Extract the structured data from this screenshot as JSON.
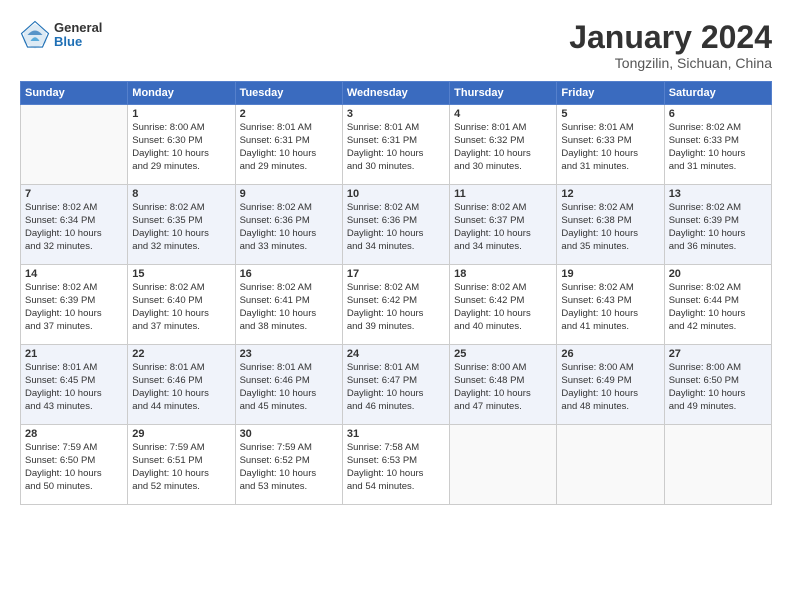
{
  "header": {
    "logo_general": "General",
    "logo_blue": "Blue",
    "month_title": "January 2024",
    "location": "Tongzilin, Sichuan, China"
  },
  "calendar": {
    "days_of_week": [
      "Sunday",
      "Monday",
      "Tuesday",
      "Wednesday",
      "Thursday",
      "Friday",
      "Saturday"
    ],
    "weeks": [
      [
        {
          "day": "",
          "info": ""
        },
        {
          "day": "1",
          "info": "Sunrise: 8:00 AM\nSunset: 6:30 PM\nDaylight: 10 hours\nand 29 minutes."
        },
        {
          "day": "2",
          "info": "Sunrise: 8:01 AM\nSunset: 6:31 PM\nDaylight: 10 hours\nand 29 minutes."
        },
        {
          "day": "3",
          "info": "Sunrise: 8:01 AM\nSunset: 6:31 PM\nDaylight: 10 hours\nand 30 minutes."
        },
        {
          "day": "4",
          "info": "Sunrise: 8:01 AM\nSunset: 6:32 PM\nDaylight: 10 hours\nand 30 minutes."
        },
        {
          "day": "5",
          "info": "Sunrise: 8:01 AM\nSunset: 6:33 PM\nDaylight: 10 hours\nand 31 minutes."
        },
        {
          "day": "6",
          "info": "Sunrise: 8:02 AM\nSunset: 6:33 PM\nDaylight: 10 hours\nand 31 minutes."
        }
      ],
      [
        {
          "day": "7",
          "info": "Sunrise: 8:02 AM\nSunset: 6:34 PM\nDaylight: 10 hours\nand 32 minutes."
        },
        {
          "day": "8",
          "info": "Sunrise: 8:02 AM\nSunset: 6:35 PM\nDaylight: 10 hours\nand 32 minutes."
        },
        {
          "day": "9",
          "info": "Sunrise: 8:02 AM\nSunset: 6:36 PM\nDaylight: 10 hours\nand 33 minutes."
        },
        {
          "day": "10",
          "info": "Sunrise: 8:02 AM\nSunset: 6:36 PM\nDaylight: 10 hours\nand 34 minutes."
        },
        {
          "day": "11",
          "info": "Sunrise: 8:02 AM\nSunset: 6:37 PM\nDaylight: 10 hours\nand 34 minutes."
        },
        {
          "day": "12",
          "info": "Sunrise: 8:02 AM\nSunset: 6:38 PM\nDaylight: 10 hours\nand 35 minutes."
        },
        {
          "day": "13",
          "info": "Sunrise: 8:02 AM\nSunset: 6:39 PM\nDaylight: 10 hours\nand 36 minutes."
        }
      ],
      [
        {
          "day": "14",
          "info": "Sunrise: 8:02 AM\nSunset: 6:39 PM\nDaylight: 10 hours\nand 37 minutes."
        },
        {
          "day": "15",
          "info": "Sunrise: 8:02 AM\nSunset: 6:40 PM\nDaylight: 10 hours\nand 37 minutes."
        },
        {
          "day": "16",
          "info": "Sunrise: 8:02 AM\nSunset: 6:41 PM\nDaylight: 10 hours\nand 38 minutes."
        },
        {
          "day": "17",
          "info": "Sunrise: 8:02 AM\nSunset: 6:42 PM\nDaylight: 10 hours\nand 39 minutes."
        },
        {
          "day": "18",
          "info": "Sunrise: 8:02 AM\nSunset: 6:42 PM\nDaylight: 10 hours\nand 40 minutes."
        },
        {
          "day": "19",
          "info": "Sunrise: 8:02 AM\nSunset: 6:43 PM\nDaylight: 10 hours\nand 41 minutes."
        },
        {
          "day": "20",
          "info": "Sunrise: 8:02 AM\nSunset: 6:44 PM\nDaylight: 10 hours\nand 42 minutes."
        }
      ],
      [
        {
          "day": "21",
          "info": "Sunrise: 8:01 AM\nSunset: 6:45 PM\nDaylight: 10 hours\nand 43 minutes."
        },
        {
          "day": "22",
          "info": "Sunrise: 8:01 AM\nSunset: 6:46 PM\nDaylight: 10 hours\nand 44 minutes."
        },
        {
          "day": "23",
          "info": "Sunrise: 8:01 AM\nSunset: 6:46 PM\nDaylight: 10 hours\nand 45 minutes."
        },
        {
          "day": "24",
          "info": "Sunrise: 8:01 AM\nSunset: 6:47 PM\nDaylight: 10 hours\nand 46 minutes."
        },
        {
          "day": "25",
          "info": "Sunrise: 8:00 AM\nSunset: 6:48 PM\nDaylight: 10 hours\nand 47 minutes."
        },
        {
          "day": "26",
          "info": "Sunrise: 8:00 AM\nSunset: 6:49 PM\nDaylight: 10 hours\nand 48 minutes."
        },
        {
          "day": "27",
          "info": "Sunrise: 8:00 AM\nSunset: 6:50 PM\nDaylight: 10 hours\nand 49 minutes."
        }
      ],
      [
        {
          "day": "28",
          "info": "Sunrise: 7:59 AM\nSunset: 6:50 PM\nDaylight: 10 hours\nand 50 minutes."
        },
        {
          "day": "29",
          "info": "Sunrise: 7:59 AM\nSunset: 6:51 PM\nDaylight: 10 hours\nand 52 minutes."
        },
        {
          "day": "30",
          "info": "Sunrise: 7:59 AM\nSunset: 6:52 PM\nDaylight: 10 hours\nand 53 minutes."
        },
        {
          "day": "31",
          "info": "Sunrise: 7:58 AM\nSunset: 6:53 PM\nDaylight: 10 hours\nand 54 minutes."
        },
        {
          "day": "",
          "info": ""
        },
        {
          "day": "",
          "info": ""
        },
        {
          "day": "",
          "info": ""
        }
      ]
    ]
  }
}
